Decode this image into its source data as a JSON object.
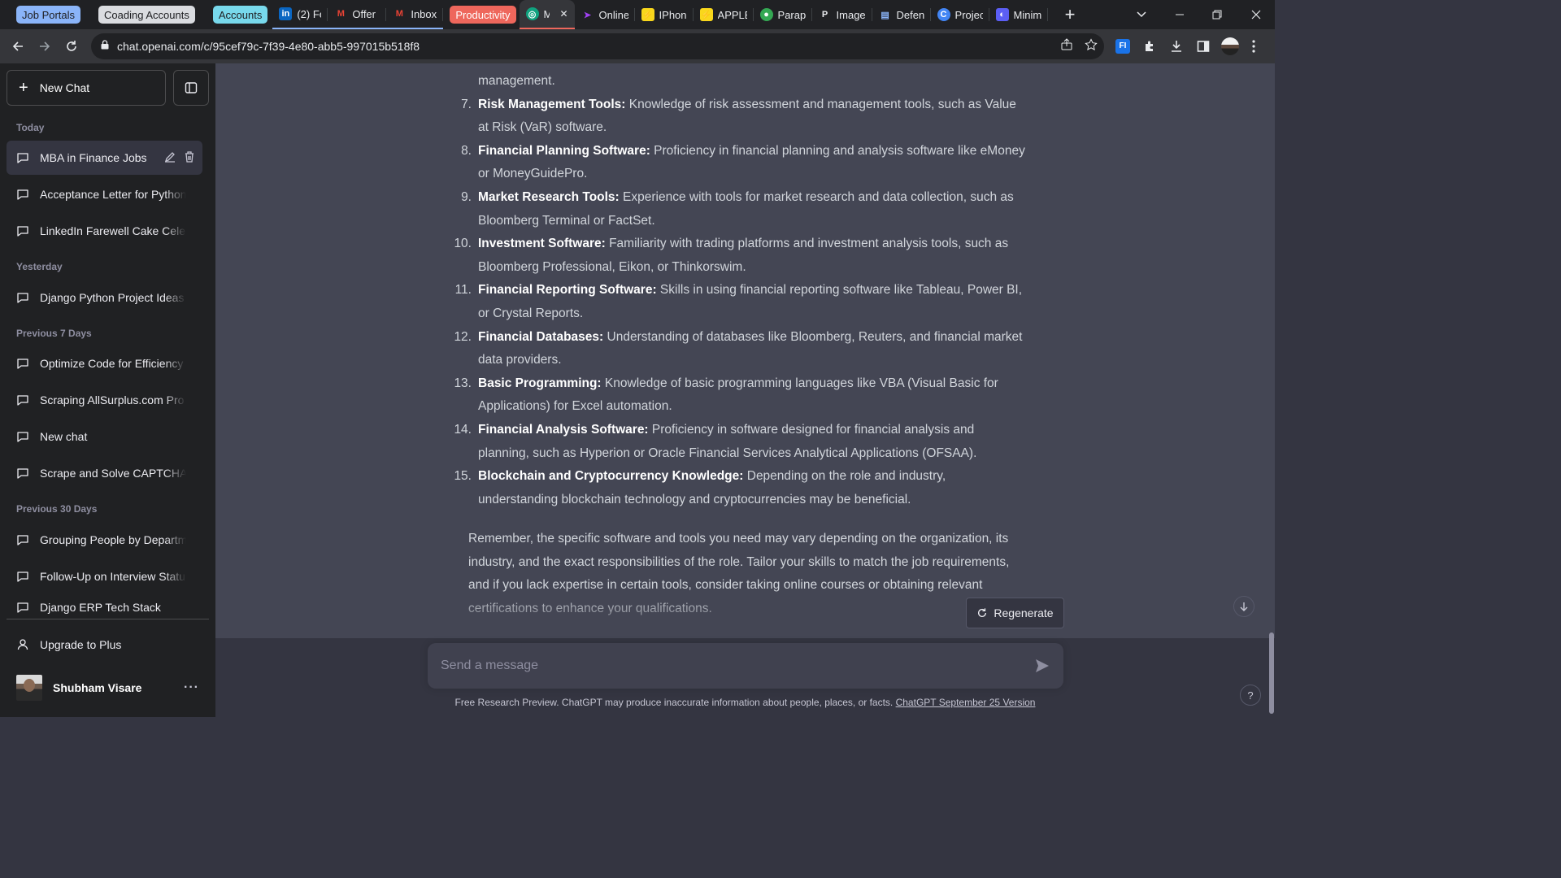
{
  "browser": {
    "tab_groups": [
      {
        "label": "Job Portals",
        "color": "#8ab4f8"
      },
      {
        "label": "Coading Accounts",
        "color": "#dadce0"
      },
      {
        "label": "Accounts",
        "color": "#78d9ec"
      },
      {
        "label": "Productivity",
        "color": "#ee675c"
      }
    ],
    "tabs": [
      {
        "title": "(2) Fe",
        "icon": "linkedin-icon"
      },
      {
        "title": "Offer",
        "icon": "gmail-icon"
      },
      {
        "title": "Inbox",
        "icon": "gmail-icon"
      },
      {
        "title": "M",
        "icon": "chatgpt-icon",
        "close": "✕"
      },
      {
        "title": "Online",
        "icon": "app-icon"
      },
      {
        "title": "IPhon",
        "icon": "flash-icon"
      },
      {
        "title": "APPLE",
        "icon": "flash-icon"
      },
      {
        "title": "Parap",
        "icon": "paraphrase-icon"
      },
      {
        "title": "Image",
        "icon": "p-icon"
      },
      {
        "title": "Defen",
        "icon": "doc-icon"
      },
      {
        "title": "Projec",
        "icon": "c-icon"
      },
      {
        "title": "Minim",
        "icon": "app-icon"
      }
    ],
    "new_tab": "+",
    "url": "chat.openai.com/c/95cef79c-7f39-4e80-abb5-997015b518f8"
  },
  "sidebar": {
    "new_chat_label": "New Chat",
    "sections": [
      {
        "title": "Today",
        "items": [
          "MBA in Finance Jobs",
          "Acceptance Letter for Python",
          "LinkedIn Farewell Cake Celeb"
        ]
      },
      {
        "title": "Yesterday",
        "items": [
          "Django Python Project Ideas"
        ]
      },
      {
        "title": "Previous 7 Days",
        "items": [
          "Optimize Code for Efficiency",
          "Scraping AllSurplus.com Pro",
          "New chat",
          "Scrape and Solve CAPTCHA"
        ]
      },
      {
        "title": "Previous 30 Days",
        "items": [
          "Grouping People by Departm",
          "Follow-Up on Interview Statu",
          "Django ERP Tech Stack"
        ]
      }
    ],
    "upgrade_label": "Upgrade to Plus",
    "user_name": "Shubham Visare",
    "more": "···"
  },
  "conversation": {
    "top_fragment": "management.",
    "items": [
      {
        "num": "7.",
        "bold": "Risk Management Tools:",
        "text": " Knowledge of risk assessment and management tools, such as Value at Risk (VaR) software."
      },
      {
        "num": "8.",
        "bold": "Financial Planning Software:",
        "text": " Proficiency in financial planning and analysis software like eMoney or MoneyGuidePro."
      },
      {
        "num": "9.",
        "bold": "Market Research Tools:",
        "text": " Experience with tools for market research and data collection, such as Bloomberg Terminal or FactSet."
      },
      {
        "num": "10.",
        "bold": "Investment Software:",
        "text": " Familiarity with trading platforms and investment analysis tools, such as Bloomberg Professional, Eikon, or Thinkorswim."
      },
      {
        "num": "11.",
        "bold": "Financial Reporting Software:",
        "text": " Skills in using financial reporting software like Tableau, Power BI, or Crystal Reports."
      },
      {
        "num": "12.",
        "bold": "Financial Databases:",
        "text": " Understanding of databases like Bloomberg, Reuters, and financial market data providers."
      },
      {
        "num": "13.",
        "bold": "Basic Programming:",
        "text": " Knowledge of basic programming languages like VBA (Visual Basic for Applications) for Excel automation."
      },
      {
        "num": "14.",
        "bold": "Financial Analysis Software:",
        "text": " Proficiency in software designed for financial analysis and planning, such as Hyperion or Oracle Financial Services Analytical Applications (OFSAA)."
      },
      {
        "num": "15.",
        "bold": "Blockchain and Cryptocurrency Knowledge:",
        "text": " Depending on the role and industry, understanding blockchain technology and cryptocurrencies may be beneficial."
      }
    ],
    "closing": "Remember, the specific software and tools you need may vary depending on the organization, its industry, and the exact responsibilities of the role. Tailor your skills to match the job requirements, and if you lack expertise in certain tools, consider taking online courses or obtaining relevant certifications to enhance your qualifications."
  },
  "composer": {
    "regenerate_label": "Regenerate",
    "placeholder": "Send a message",
    "footer_text": "Free Research Preview. ChatGPT may produce inaccurate information about people, places, or facts. ",
    "footer_link": "ChatGPT September 25 Version",
    "help": "?"
  }
}
